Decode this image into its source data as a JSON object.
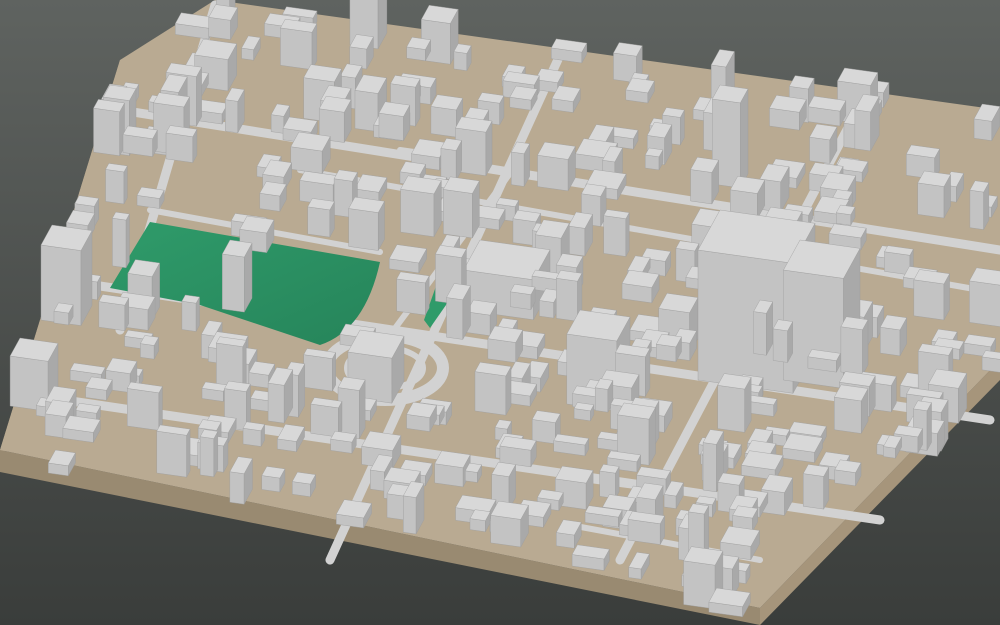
{
  "colors": {
    "background_top": "#5f6360",
    "background_bottom": "#3a3d3b",
    "terrain": "#b9aa92",
    "terrain_side": "#a6957b",
    "terrain_front": "#998a71",
    "road": "#d2d2d2",
    "building_top": "#d8d8d8",
    "building_left": "#c3c3c3",
    "building_right": "#a9a9a9",
    "park": "#2f9b6a",
    "park_dark": "#26845a"
  },
  "icons": {
    "park": "park-area",
    "roundabout": "roundabout-junction"
  }
}
